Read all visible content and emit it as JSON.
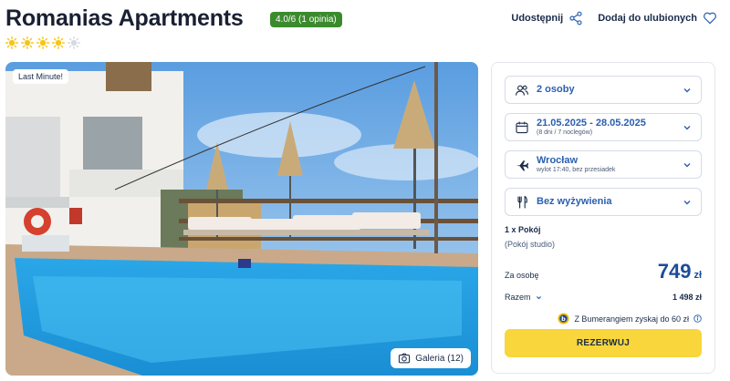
{
  "header": {
    "title": "Romanias Apartments",
    "rating": "4.0/6 (1 opinia)",
    "stars": 4,
    "stars_max": 5,
    "share_label": "Udostępnij",
    "favorite_label": "Dodaj do ulubionych"
  },
  "photo": {
    "badge": "Last Minute!",
    "gallery_label": "Galeria (12)"
  },
  "booking": {
    "persons": "2 osoby",
    "dates": "21.05.2025 - 28.05.2025",
    "dates_sub": "(8 dni / 7 noclegów)",
    "departure": "Wrocław",
    "departure_sub": "wylot 17:40, bez przesiadek",
    "board": "Bez wyżywienia",
    "room_title": "1 x Pokój",
    "room_type": "(Pokój studio)",
    "per_person_label": "Za osobę",
    "per_person_price": "749",
    "currency": "zł",
    "total_label": "Razem",
    "total_value": "1 498 zł",
    "bumerang_text": "Z Bumerangiem zyskaj do 60 zł",
    "reserve_label": "REZERWUJ"
  },
  "colors": {
    "rating_green": "#3c8a2e",
    "accent_blue": "#2a5fb0",
    "price_blue": "#1a4d9a",
    "button_yellow": "#f8d63c",
    "star_yellow": "#f5c518"
  }
}
